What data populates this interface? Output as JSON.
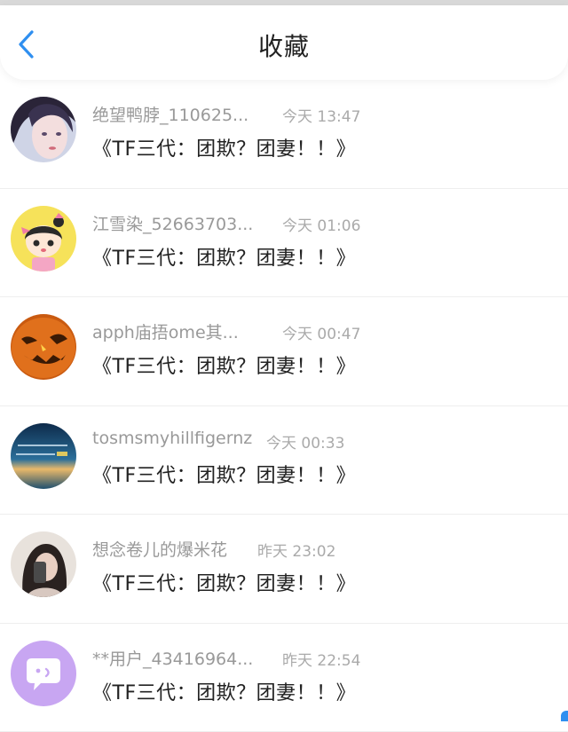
{
  "header": {
    "title": "收藏"
  },
  "colors": {
    "accent": "#2f8ff0"
  },
  "items": [
    {
      "name": "绝望鸭脖_110625...",
      "time": "今天 13:47",
      "story": "《TF三代：团欺？团妻！！》",
      "avatar": "girl-portrait-avatar"
    },
    {
      "name": "江雪染_52663703...",
      "time": "今天 01:06",
      "story": "《TF三代：团欺？团妻！！》",
      "avatar": "cartoon-girl-avatar"
    },
    {
      "name": "apph庙捂ome其...",
      "time": "今天 00:47",
      "story": "《TF三代：团欺？团妻！！》",
      "avatar": "pumpkin-avatar"
    },
    {
      "name": "tosmsmyhillfigernz",
      "time": "今天 00:33",
      "story": "《TF三代：团欺？团妻！！》",
      "avatar": "sunset-text-avatar"
    },
    {
      "name": "想念卷儿的爆米花",
      "time": "昨天 23:02",
      "story": "《TF三代：团欺？团妻！！》",
      "avatar": "selfie-avatar"
    },
    {
      "name": "**用户_43416964...",
      "time": "昨天 22:54",
      "story": "《TF三代：团欺？团妻！！》",
      "avatar": "default-chat-avatar"
    }
  ]
}
